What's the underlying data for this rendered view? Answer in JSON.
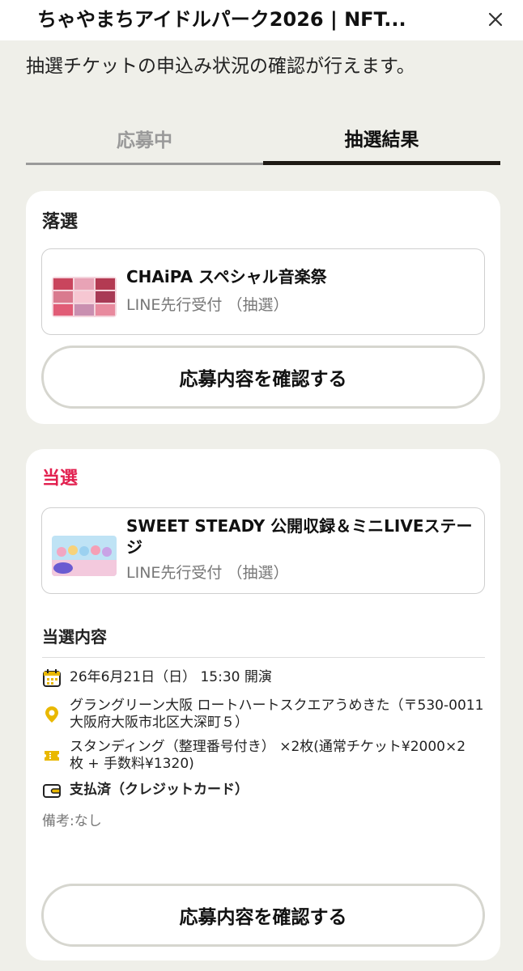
{
  "header": {
    "title": "ちゃやまちアイドルパーク2026 | NFT...",
    "close_icon": "close-icon"
  },
  "subtitle": "抽選チケットの申込み状況の確認が行えます。",
  "tabs": [
    {
      "label": "応募中",
      "active": false
    },
    {
      "label": "抽選結果",
      "active": true
    }
  ],
  "results": [
    {
      "status": "落選",
      "status_color": "#222222",
      "event_name": "CHAiPA スペシャル音楽祭",
      "event_type": "LINE先行受付 （抽選）",
      "button_label": "応募内容を確認する"
    },
    {
      "status": "当選",
      "status_color": "#e2204f",
      "event_name": "SWEET STEADY 公開収録＆ミニLIVEステージ",
      "event_type": "LINE先行受付 （抽選）",
      "details_heading": "当選内容",
      "details": {
        "date": "26年6月21日（日） 15:30 開演",
        "venue": "グラングリーン大阪 ロートハートスクエアうめきた（〒530-0011 大阪府大阪市北区大深町５）",
        "ticket": "スタンディング（整理番号付き） ×2枚(通常チケット¥2000×2枚 + 手数料¥1320)",
        "payment": "支払済（クレジットカード）"
      },
      "note": "備考:なし",
      "button_label": "応募内容を確認する"
    }
  ],
  "colors": {
    "background": "#efefe9",
    "accent_win": "#e2204f",
    "icon_yellow": "#e9b800"
  }
}
